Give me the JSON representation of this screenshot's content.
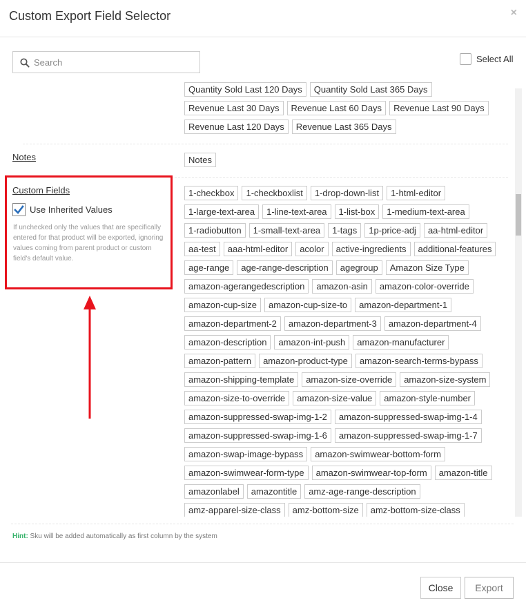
{
  "dialog": {
    "title": "Custom Export Field Selector",
    "close_glyph": "×"
  },
  "search": {
    "placeholder": "Search",
    "value": ""
  },
  "select_all": {
    "label": "Select All",
    "checked": false
  },
  "sections": {
    "top_tags_row1": [
      "Quantity Sold Last 120 Days",
      "Quantity Sold Last 365 Days"
    ],
    "top_tags": [
      "Revenue Last 30 Days",
      "Revenue Last 60 Days",
      "Revenue Last 90 Days",
      "Revenue Last 120 Days",
      "Revenue Last 365 Days"
    ],
    "notes": {
      "label": "Notes",
      "tags": [
        "Notes"
      ]
    },
    "custom_fields": {
      "label": "Custom Fields",
      "use_inherited": {
        "label": "Use Inherited Values",
        "checked": true
      },
      "help": "If unchecked only the values that are specifically entered for that product will be exported, ignoring values coming from parent product or custom field's default value.",
      "tags": [
        "1-checkbox",
        "1-checkboxlist",
        "1-drop-down-list",
        "1-html-editor",
        "1-large-text-area",
        "1-line-text-area",
        "1-list-box",
        "1-medium-text-area",
        "1-radiobutton",
        "1-small-text-area",
        "1-tags",
        "1p-price-adj",
        "aa-html-editor",
        "aa-test",
        "aaa-html-editor",
        "acolor",
        "active-ingredients",
        "additional-features",
        "age-range",
        "age-range-description",
        "agegroup",
        "Amazon Size Type",
        "amazon-agerangedescription",
        "amazon-asin",
        "amazon-color-override",
        "amazon-cup-size",
        "amazon-cup-size-to",
        "amazon-department-1",
        "amazon-department-2",
        "amazon-department-3",
        "amazon-department-4",
        "amazon-description",
        "amazon-int-push",
        "amazon-manufacturer",
        "amazon-pattern",
        "amazon-product-type",
        "amazon-search-terms-bypass",
        "amazon-shipping-template",
        "amazon-size-override",
        "amazon-size-system",
        "amazon-size-to-override",
        "amazon-size-value",
        "amazon-style-number",
        "amazon-suppressed-swap-img-1-2",
        "amazon-suppressed-swap-img-1-4",
        "amazon-suppressed-swap-img-1-6",
        "amazon-suppressed-swap-img-1-7",
        "amazon-swap-image-bypass",
        "amazon-swimwear-bottom-form",
        "amazon-swimwear-form-type",
        "amazon-swimwear-top-form",
        "amazon-title",
        "amazonlabel",
        "amazontitle",
        "amz-age-range-description",
        "amz-apparel-size-class",
        "amz-bottom-size",
        "amz-bottom-size-class"
      ]
    }
  },
  "hint": {
    "key": "Hint:",
    "text": " Sku will be added automatically as first column by the system"
  },
  "footer": {
    "close_label": "Close",
    "export_label": "Export"
  },
  "annotation": {
    "highlight_color": "#e8131d"
  }
}
